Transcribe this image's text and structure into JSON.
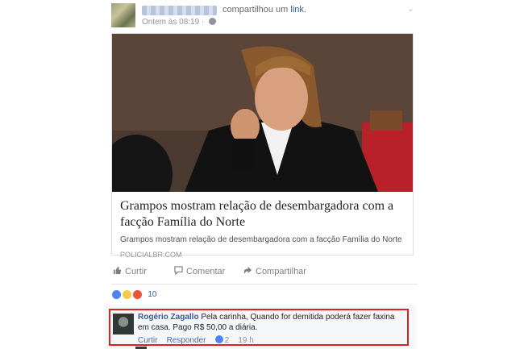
{
  "post": {
    "shared_text": "compartilhou um",
    "shared_link": "link",
    "shared_suffix": ".",
    "timestamp": "Ontem às 08:19 ·"
  },
  "link_card": {
    "title": "Grampos mostram relação de desembargadora com a facção Família do Norte",
    "description": "Grampos mostram relação de desembargadora com a facção Família do Norte",
    "domain": "POLICIALBR.COM"
  },
  "actions": {
    "like": "Curtir",
    "comment": "Comentar",
    "share": "Compartilhar"
  },
  "reactions": {
    "icons": [
      "like-icon",
      "wow-icon",
      "angry-icon"
    ],
    "count": "10"
  },
  "comment": {
    "author": "Rogério Zagallo",
    "text": "Pela carinha, Quando for demitida poderá fazer faxina em casa. Pago R$ 50,00 a diária.",
    "like_label": "Curtir",
    "reply_label": "Responder",
    "likes_count": "2",
    "time": "19 h"
  },
  "colors": {
    "link_blue": "#365899",
    "highlight_border": "#e02020",
    "comment_bg": "#f6f7f9"
  }
}
